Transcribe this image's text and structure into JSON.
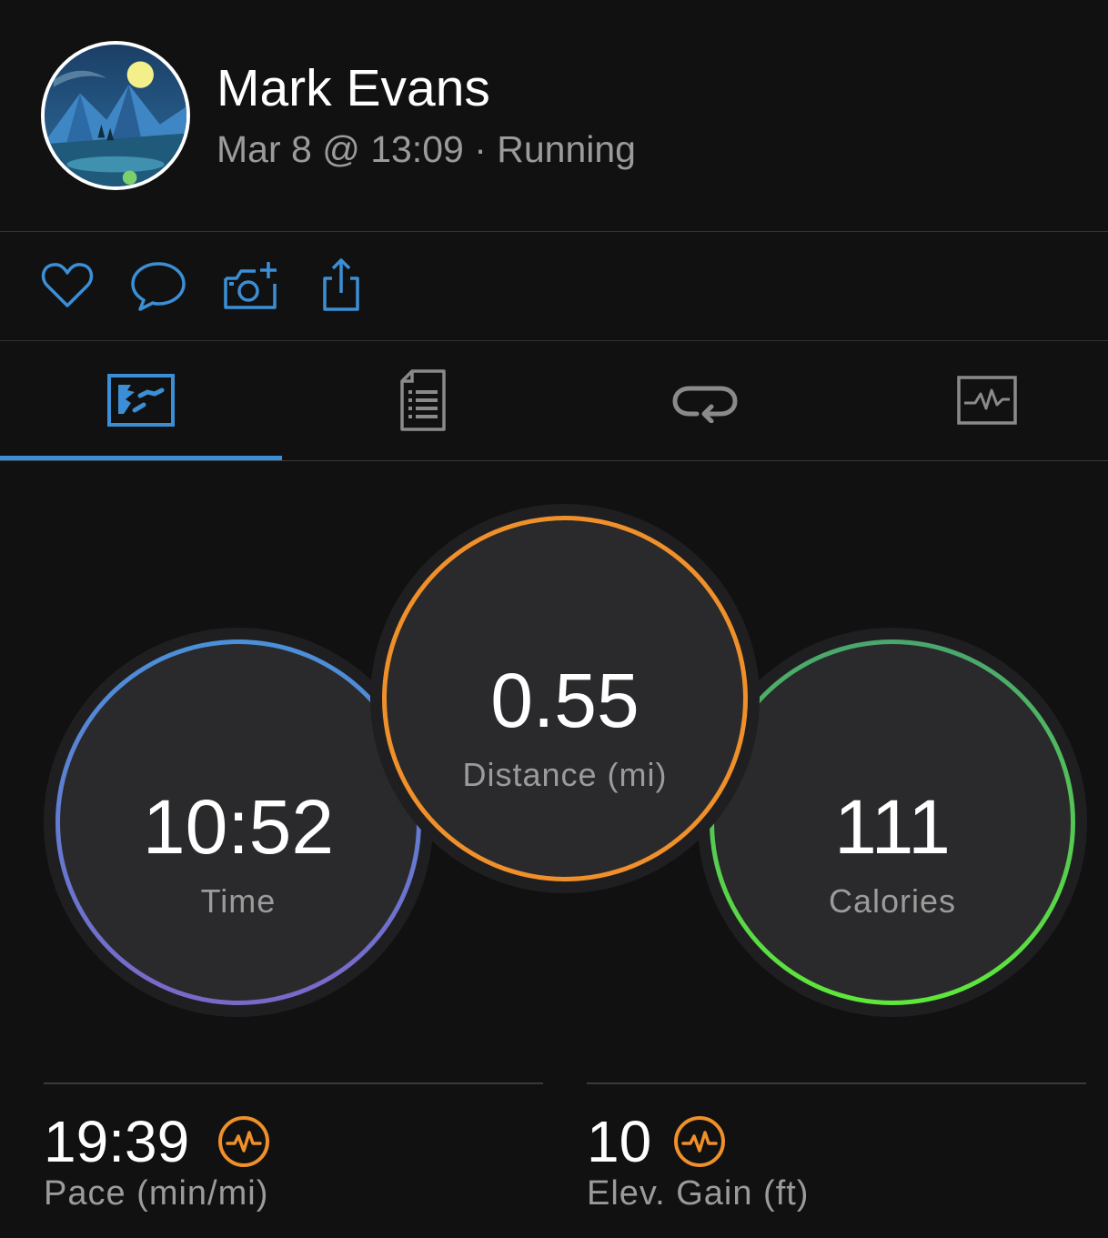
{
  "header": {
    "user_name": "Mark Evans",
    "activity_meta": "Mar 8 @ 13:09 · Running"
  },
  "actions": [
    {
      "name": "like",
      "icon": "heart-icon"
    },
    {
      "name": "comment",
      "icon": "comment-icon"
    },
    {
      "name": "add-photo",
      "icon": "camera-add-icon"
    },
    {
      "name": "share",
      "icon": "share-icon"
    }
  ],
  "tabs": [
    {
      "name": "overview",
      "icon": "overview-map-icon",
      "active": true
    },
    {
      "name": "stats",
      "icon": "document-list-icon",
      "active": false
    },
    {
      "name": "laps",
      "icon": "repeat-icon",
      "active": false
    },
    {
      "name": "charts",
      "icon": "activity-chart-icon",
      "active": false
    }
  ],
  "summary": {
    "time": {
      "value": "10:52",
      "label": "Time"
    },
    "distance": {
      "value": "0.55",
      "label": "Distance (mi)"
    },
    "calories": {
      "value": "111",
      "label": "Calories"
    }
  },
  "stats": {
    "pace": {
      "value": "19:39",
      "label": "Pace (min/mi)",
      "icon": "pulse-icon"
    },
    "elevation": {
      "value": "10",
      "label": "Elev. Gain (ft)",
      "icon": "pulse-icon"
    }
  },
  "colors": {
    "background": "#111111",
    "accent_blue": "#3b8fd6",
    "time_ring_start": "#4a90d9",
    "time_ring_end": "#7b68c9",
    "distance_ring": "#f0902a",
    "calories_ring_start": "#4aa66e",
    "calories_ring_end": "#5ee83a",
    "stat_icon": "#f0902a",
    "secondary_text": "#9b9b9b"
  }
}
